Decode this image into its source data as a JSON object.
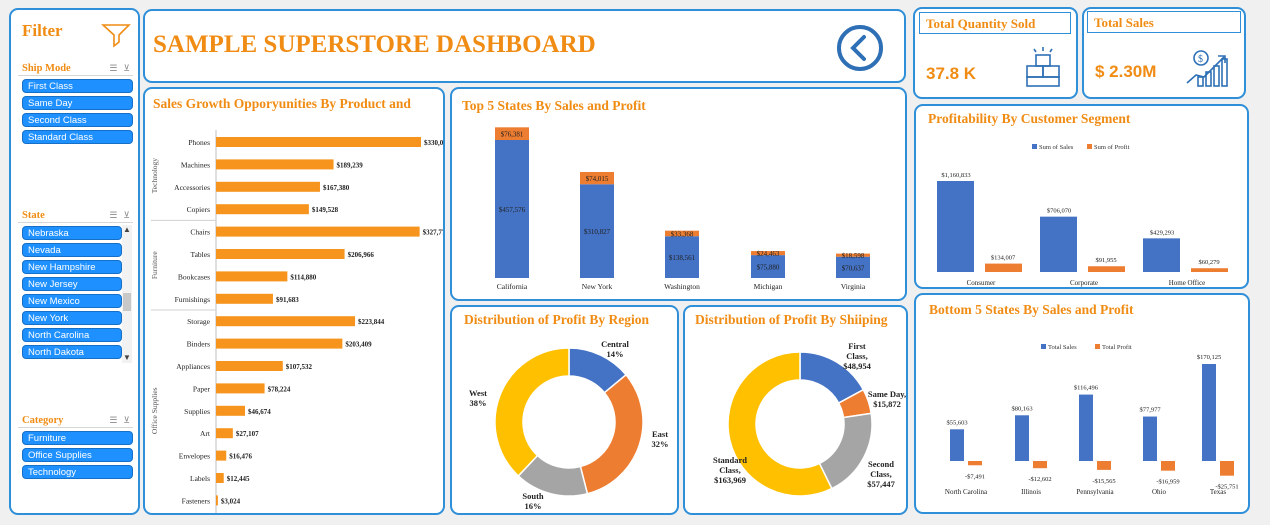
{
  "filter": {
    "title": "Filter",
    "ship_mode": {
      "title": "Ship Mode",
      "items": [
        "First Class",
        "Same Day",
        "Second Class",
        "Standard Class"
      ]
    },
    "state": {
      "title": "State",
      "items": [
        "Nebraska",
        "Nevada",
        "New Hampshire",
        "New Jersey",
        "New Mexico",
        "New York",
        "North Carolina",
        "North Dakota"
      ]
    },
    "category": {
      "title": "Category",
      "items": [
        "Furniture",
        "Office Supplies",
        "Technology"
      ]
    }
  },
  "header": {
    "title": "SAMPLE SUPERSTORE DASHBOARD",
    "back_icon": "back-circle-icon"
  },
  "kpis": {
    "quantity": {
      "label": "Total Quantity Sold",
      "value": "37.8 K",
      "icon": "boxes-icon"
    },
    "sales": {
      "label": "Total Sales",
      "value": "$ 2.30M",
      "icon": "growth-chart-icon"
    }
  },
  "colors": {
    "orange": "#f7941d",
    "blue": "#4472c4",
    "accent_orange": "#ed7d31",
    "gray": "#a5a5a5",
    "yellow": "#ffc000",
    "border": "#2f8fd8"
  },
  "chart_data": [
    {
      "id": "subcategory",
      "type": "bar",
      "title": "Sales Growth Opporyunities By Product and",
      "orientation": "horizontal",
      "groups": [
        {
          "name": "Technology",
          "categories": [
            "Phones",
            "Machines",
            "Accessories",
            "Copiers"
          ],
          "values": [
            330007,
            189239,
            167380,
            149528
          ],
          "labels": [
            "$330,007",
            "$189,239",
            "$167,380",
            "$149,528"
          ]
        },
        {
          "name": "Furniture",
          "categories": [
            "Chairs",
            "Tables",
            "Bookcases",
            "Furnishings"
          ],
          "values": [
            327778,
            206966,
            114880,
            91683
          ],
          "labels": [
            "$327,778",
            "$206,966",
            "$114,880",
            "$91,683"
          ]
        },
        {
          "name": "Office Supplies",
          "categories": [
            "Storage",
            "Binders",
            "Appliances",
            "Paper",
            "Supplies",
            "Art",
            "Envelopes",
            "Labels",
            "Fasteners"
          ],
          "values": [
            223844,
            203409,
            107532,
            78224,
            46674,
            27107,
            16476,
            12445,
            3024
          ],
          "labels": [
            "$223,844",
            "$203,409",
            "$107,532",
            "$78,224",
            "$46,674",
            "$27,107",
            "$16,476",
            "$12,445",
            "$3,024"
          ]
        }
      ],
      "xlim": [
        0,
        330007
      ]
    },
    {
      "id": "top5",
      "type": "bar",
      "stacked": true,
      "title": "Top 5 States By Sales and Profit",
      "categories": [
        "California",
        "New York",
        "Washington",
        "Michigan",
        "Virginia"
      ],
      "series": [
        {
          "values": [
            457576,
            310827,
            138561,
            75880,
            70637
          ],
          "labels": [
            "$457,576",
            "$310,827",
            "$138,561",
            "$75,880",
            "$70,637"
          ]
        },
        {
          "values": [
            76381,
            74015,
            33368,
            24463,
            18598
          ],
          "labels": [
            "$76,381",
            "$74,015",
            "$33,368",
            "$24,463",
            "$18,598"
          ]
        }
      ]
    },
    {
      "id": "segment",
      "type": "bar",
      "title": "Profitability By Customer Segment",
      "categories": [
        "Consumer",
        "Corporate",
        "Home Office"
      ],
      "legend": [
        "Sum of Sales",
        "Sum of Profit"
      ],
      "legend_position": "top",
      "series": [
        {
          "name": "Sum of Sales",
          "values": [
            1160833,
            706070,
            429293
          ],
          "labels": [
            "$1,160,833",
            "$706,070",
            "$429,293"
          ]
        },
        {
          "name": "Sum of Profit",
          "values": [
            134007,
            91955,
            60279
          ],
          "labels": [
            "$134,007",
            "$91,955",
            "$60,279"
          ]
        }
      ]
    },
    {
      "id": "region",
      "type": "pie",
      "donut": true,
      "title": "Distribution of Profit By Region",
      "slices": [
        {
          "name": "Central",
          "value": 14,
          "label": "Central\n14%"
        },
        {
          "name": "East",
          "value": 32,
          "label": "East\n32%"
        },
        {
          "name": "South",
          "value": 16,
          "label": "South\n16%"
        },
        {
          "name": "West",
          "value": 38,
          "label": "West\n38%"
        }
      ]
    },
    {
      "id": "shipping",
      "type": "pie",
      "donut": true,
      "title": "Distribution of Profit By Shiiping",
      "slices": [
        {
          "name": "First Class",
          "value": 48954,
          "label": "First\nClass,\n$48,954"
        },
        {
          "name": "Same Day",
          "value": 15872,
          "label": "Same Day,\n$15,872"
        },
        {
          "name": "Second Class",
          "value": 57447,
          "label": "Second\nClass,\n$57,447"
        },
        {
          "name": "Standard Class",
          "value": 163969,
          "label": "Standard\nClass,\n$163,969"
        }
      ]
    },
    {
      "id": "bottom5",
      "type": "bar",
      "title": "Bottom 5 States By Sales and Profit",
      "categories": [
        "North Carolina",
        "Illinois",
        "Pennsylvania",
        "Ohio",
        "Texas"
      ],
      "legend": [
        "Total Sales",
        "Total Profit"
      ],
      "legend_position": "top",
      "series": [
        {
          "name": "Total Sales",
          "values": [
            55603,
            80163,
            116496,
            77977,
            170125
          ],
          "labels": [
            "$55,603",
            "$80,163",
            "$116,496",
            "$77,977",
            "$170,125"
          ]
        },
        {
          "name": "Total Profit",
          "values": [
            -7491,
            -12602,
            -15565,
            -16959,
            -25751
          ],
          "labels": [
            "-$7,491",
            "-$12,602",
            "-$15,565",
            "-$16,959",
            "-$25,751"
          ]
        }
      ]
    }
  ]
}
